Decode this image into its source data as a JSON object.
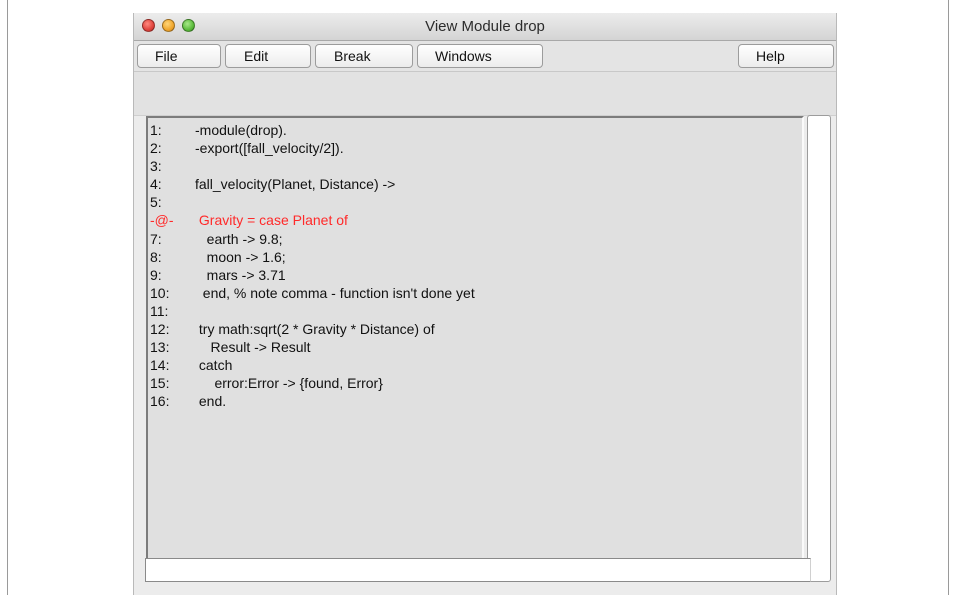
{
  "window": {
    "title": "View Module drop"
  },
  "menubar": {
    "items": [
      {
        "label": "File"
      },
      {
        "label": "Edit"
      },
      {
        "label": "Break"
      },
      {
        "label": "Windows"
      },
      {
        "label": "Help"
      }
    ]
  },
  "code": {
    "highlight_color": "#ff2a2a",
    "lines": [
      {
        "num": "1:",
        "text": "-module(drop)."
      },
      {
        "num": "2:",
        "text": "-export([fall_velocity/2])."
      },
      {
        "num": "3:",
        "text": ""
      },
      {
        "num": "4:",
        "text": "fall_velocity(Planet, Distance) ->"
      },
      {
        "num": "5:",
        "text": ""
      },
      {
        "num": "-@-",
        "text": " Gravity = case Planet of",
        "highlighted": true
      },
      {
        "num": "7:",
        "text": "   earth -> 9.8;"
      },
      {
        "num": "8:",
        "text": "   moon -> 1.6;"
      },
      {
        "num": "9:",
        "text": "   mars -> 3.71"
      },
      {
        "num": "10:",
        "text": "  end, % note comma - function isn't done yet"
      },
      {
        "num": "11:",
        "text": ""
      },
      {
        "num": "12:",
        "text": " try math:sqrt(2 * Gravity * Distance) of"
      },
      {
        "num": "13:",
        "text": "    Result -> Result"
      },
      {
        "num": "14:",
        "text": " catch"
      },
      {
        "num": "15:",
        "text": "     error:Error -> {found, Error}"
      },
      {
        "num": "16:",
        "text": " end."
      }
    ]
  },
  "status": {
    "text": ""
  }
}
